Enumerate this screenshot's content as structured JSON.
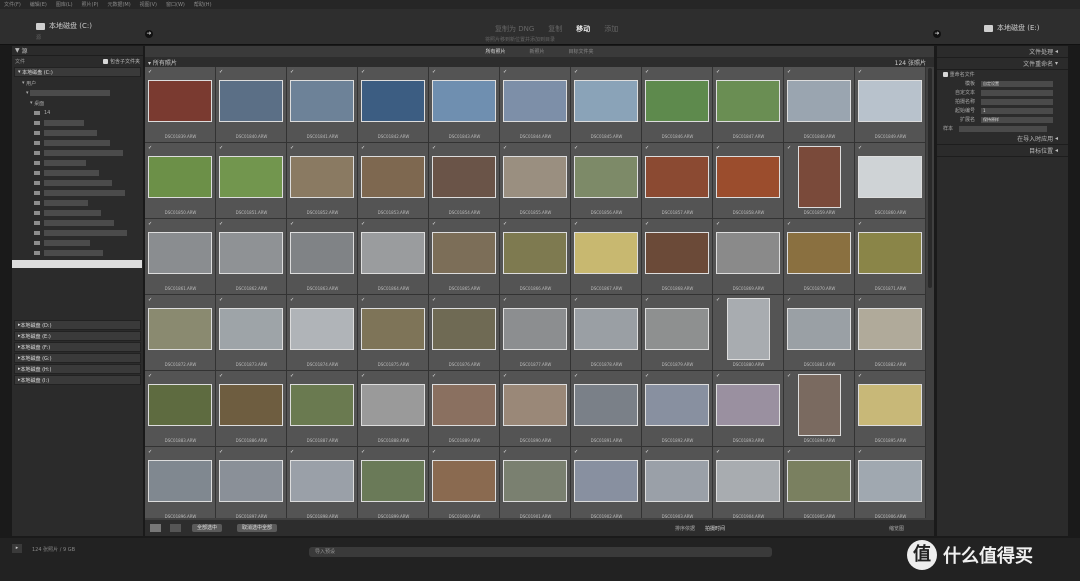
{
  "menubar": [
    "文件(F)",
    "编辑(E)",
    "图库(L)",
    "照片(P)",
    "元数据(M)",
    "视图(V)",
    "窗口(W)",
    "帮助(H)"
  ],
  "source": {
    "drive": "本地磁盘 (C:)",
    "path": "源"
  },
  "modes": {
    "items": [
      "复制为 DNG",
      "复制",
      "移动",
      "添加"
    ],
    "active": "移动",
    "subtitle": "将照片移到新位置并添加到目录"
  },
  "destination": {
    "drive": "本地磁盘 (E:)"
  },
  "left_panel": {
    "header": "源",
    "include_subfolders_label": "包含子文件夹",
    "files_label": "文件",
    "tree": [
      "本地磁盘 (C:)",
      "用户",
      "桌面",
      "14"
    ],
    "volumes": [
      "本地磁盘 (D:)",
      "本地磁盘 (E:)",
      "本地磁盘 (F:)",
      "本地磁盘 (G:)",
      "本地磁盘 (H:)",
      "本地磁盘 (I:)"
    ]
  },
  "view_tabs": {
    "items": [
      "所有照片",
      "新照片",
      "目标文件夹"
    ],
    "active": "所有照片"
  },
  "grid": {
    "header": "所有照片",
    "count": "124 张照片",
    "files": [
      "DSC01839.ARW",
      "DSC01840.ARW",
      "DSC01841.ARW",
      "DSC01842.ARW",
      "DSC01843.ARW",
      "DSC01844.ARW",
      "DSC01845.ARW",
      "DSC01846.ARW",
      "DSC01847.ARW",
      "DSC01848.ARW",
      "DSC01849.ARW",
      "DSC01850.ARW",
      "DSC01851.ARW",
      "DSC01852.ARW",
      "DSC01853.ARW",
      "DSC01854.ARW",
      "DSC01855.ARW",
      "DSC01856.ARW",
      "DSC01857.ARW",
      "DSC01858.ARW",
      "DSC01859.ARW",
      "DSC01860.ARW",
      "DSC01861.ARW",
      "DSC01862.ARW",
      "DSC01863.ARW",
      "DSC01864.ARW",
      "DSC01865.ARW",
      "DSC01866.ARW",
      "DSC01867.ARW",
      "DSC01868.ARW",
      "DSC01869.ARW",
      "DSC01870.ARW",
      "DSC01871.ARW",
      "DSC01872.ARW",
      "DSC01873.ARW",
      "DSC01874.ARW",
      "DSC01875.ARW",
      "DSC01876.ARW",
      "DSC01877.ARW",
      "DSC01878.ARW",
      "DSC01879.ARW",
      "DSC01880.ARW",
      "DSC01881.ARW",
      "DSC01882.ARW",
      "DSC01883.ARW",
      "DSC01886.ARW",
      "DSC01887.ARW",
      "DSC01888.ARW",
      "DSC01889.ARW",
      "DSC01890.ARW",
      "DSC01891.ARW",
      "DSC01892.ARW",
      "DSC01893.ARW",
      "DSC01894.ARW",
      "DSC01895.ARW",
      "DSC01896.ARW",
      "DSC01897.ARW",
      "DSC01898.ARW",
      "DSC01899.ARW",
      "DSC01900.ARW",
      "DSC01901.ARW",
      "DSC01902.ARW",
      "DSC01903.ARW",
      "DSC01904.ARW",
      "DSC01905.ARW",
      "DSC01906.ARW"
    ],
    "colors": [
      "#7a3a30",
      "#5b6f86",
      "#6d8298",
      "#3c5d82",
      "#6f8fb0",
      "#7d8fa8",
      "#8aa3b8",
      "#5e8a4d",
      "#6a8e53",
      "#9aa5b0",
      "#b8c2cc",
      "#6c9048",
      "#72964e",
      "#8a7a62",
      "#7e6850",
      "#6a5448",
      "#9a8f80",
      "#7d8a68",
      "#8b4a32",
      "#9b4d2d",
      "#7a4a3a",
      "#cfd3d6",
      "#8a8d90",
      "#8f9295",
      "#808386",
      "#9a9c9e",
      "#7c6e58",
      "#7e7a50",
      "#c8b870",
      "#6b4a38",
      "#8a8a8a",
      "#8a7040",
      "#8a8548",
      "#8a8a70",
      "#9ea4a8",
      "#b0b4b8",
      "#7e7458",
      "#6f6a54",
      "#8c8e90",
      "#9a9fa4",
      "#8e9090",
      "#a8acb0",
      "#9aa0a5",
      "#b0aa9a",
      "#5e6b40",
      "#6e5d40",
      "#6a7a50",
      "#9a9a9a",
      "#8a7060",
      "#9a8878",
      "#7a8088",
      "#8890a0",
      "#9a90a0",
      "#7a6a60",
      "#c8b878",
      "#808890",
      "#8a9098",
      "#9aa0a8",
      "#6a7a58",
      "#8a6a50",
      "#7a8070",
      "#8890a0",
      "#9aa0a8",
      "#a8acb0",
      "#7a8060",
      "#a0a8b0"
    ],
    "portrait_indices": [
      20,
      41,
      53
    ]
  },
  "toolbar": {
    "check_all": "全部选中",
    "uncheck_all": "取消选中全部",
    "sort_label": "排序依据",
    "sort_value": "拍摄时间",
    "thumbnail_label": "缩览图"
  },
  "right_panel": {
    "sections": [
      "文件处理",
      "文件重命名",
      "在导入时应用",
      "目标位置"
    ],
    "rename_label": "重命名文件",
    "fields": [
      {
        "label": "模板",
        "value": "自定设置"
      },
      {
        "label": "自定文本",
        "value": ""
      },
      {
        "label": "拍摄名称",
        "value": ""
      },
      {
        "label": "起始编号",
        "value": "1"
      },
      {
        "label": "扩展名",
        "value": "保持原样"
      }
    ],
    "example_label": "样本"
  },
  "bottombar": {
    "count": "124 张照片 / 9 GB",
    "preset_placeholder": "导入预设"
  },
  "brand": {
    "text": "什么值得买",
    "icon": "值"
  }
}
